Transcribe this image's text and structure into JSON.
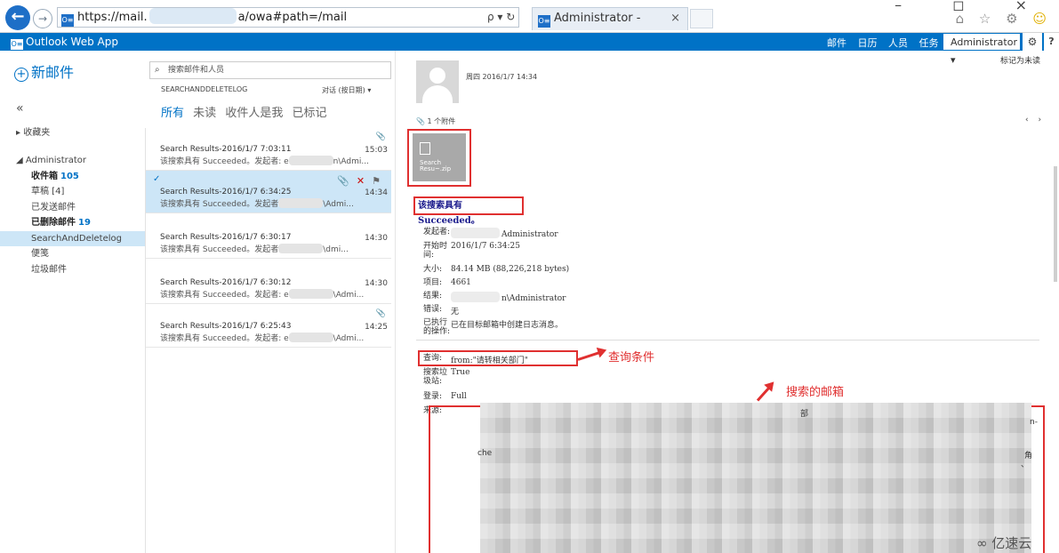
{
  "browser": {
    "url_prefix": "https://mail.",
    "url_suffix": "a/owa#path=/mail",
    "search_glyphs": "ρ ▾ ↻",
    "tab_title": "Administrator - Outlook ...",
    "tab_close": "×",
    "window_controls": "– ◻ ×",
    "toolbar_icons": "⌂ ☆ ⚙",
    "smile_icon": "☺",
    "back_glyph": "←",
    "forward_glyph": "→",
    "favicon_text": "O≡"
  },
  "owa": {
    "app_name": "Outlook Web App",
    "nav": [
      "邮件",
      "日历",
      "人员",
      "任务"
    ],
    "user": "Administrator ▾",
    "gear": "⚙",
    "help": "?"
  },
  "left": {
    "new_mail": "新邮件",
    "collapse": "«",
    "favorites": "▸ 收藏夹",
    "folders": [
      {
        "label": "◢ Administrator",
        "count": ""
      },
      {
        "label": "收件箱",
        "count": "105"
      },
      {
        "label": "草稿 [4]",
        "count": ""
      },
      {
        "label": "已发送邮件",
        "count": ""
      },
      {
        "label": "已删除邮件",
        "count": "19"
      },
      {
        "label": "SearchAndDeletelog",
        "count": ""
      },
      {
        "label": "便笺",
        "count": ""
      },
      {
        "label": "垃圾邮件",
        "count": ""
      }
    ]
  },
  "list": {
    "search_placeholder": "搜索邮件和人员",
    "folder_name": "SEARCHANDDELETELOG",
    "sort": "对话 (按日期) ▾",
    "filters": [
      "所有",
      "未读",
      "收件人是我",
      "已标记"
    ],
    "messages": [
      {
        "subject": "Search Results-2016/1/7 7:03:11",
        "preview_a": "该搜索具有 Succeeded。发起者: e",
        "preview_b": "n\\Admi...",
        "time": "15:03"
      },
      {
        "subject": "Search Results-2016/1/7 6:34:25",
        "preview_a": "该搜索具有 Succeeded。发起者",
        "preview_b": "\\Admi...",
        "time": "14:34"
      },
      {
        "subject": "Search Results-2016/1/7 6:30:17",
        "preview_a": "该搜索具有 Succeeded。发起者",
        "preview_b": "\\dmi...",
        "time": "14:30"
      },
      {
        "subject": "Search Results-2016/1/7 6:30:12",
        "preview_a": "该搜索具有 Succeeded。发起者: e",
        "preview_b": "\\Admi...",
        "time": "14:30"
      },
      {
        "subject": "Search Results-2016/1/7 6:25:43",
        "preview_a": "该搜索具有 Succeeded。发起者: e",
        "preview_b": "\\Admi...",
        "time": "14:25"
      }
    ]
  },
  "reading": {
    "date": "周四 2016/1/7 14:34",
    "mark_unread": "标记为未读",
    "attachments": "1 个附件",
    "pager": "‹ ›",
    "attachment_name_1": "Search",
    "attachment_name_2": "Resu~.zip",
    "headline": "该搜索具有 Succeeded。",
    "fields": {
      "initiator_k": "发起者:",
      "initiator_v": "Administrator",
      "start_k": "开始时间:",
      "start_v": "2016/1/7 6:34:25",
      "size_k": "大小:",
      "size_v": "84.14 MB (88,226,218 bytes)",
      "items_k": "项目:",
      "items_v": "4661",
      "result_k": "结果:",
      "result_v": "n\\Administrator",
      "errors_k": "错误:",
      "errors_v": "无",
      "action_k": "已执行的操作:",
      "action_v": "已在目标邮箱中创建日志消息。",
      "query_k": "查询:",
      "query_v": "from:\"请转相关部门\"",
      "recycle_k": "搜索垃圾站:",
      "recycle_v": "True",
      "log_k": "登录:",
      "log_v": "Full",
      "source_k": "来源:"
    },
    "annotation_query": "查询条件",
    "annotation_mailbox": "搜索的邮箱",
    "fragments": [
      "n-",
      "che",
      "部",
      "、",
      "角"
    ]
  },
  "watermark": "亿速云"
}
